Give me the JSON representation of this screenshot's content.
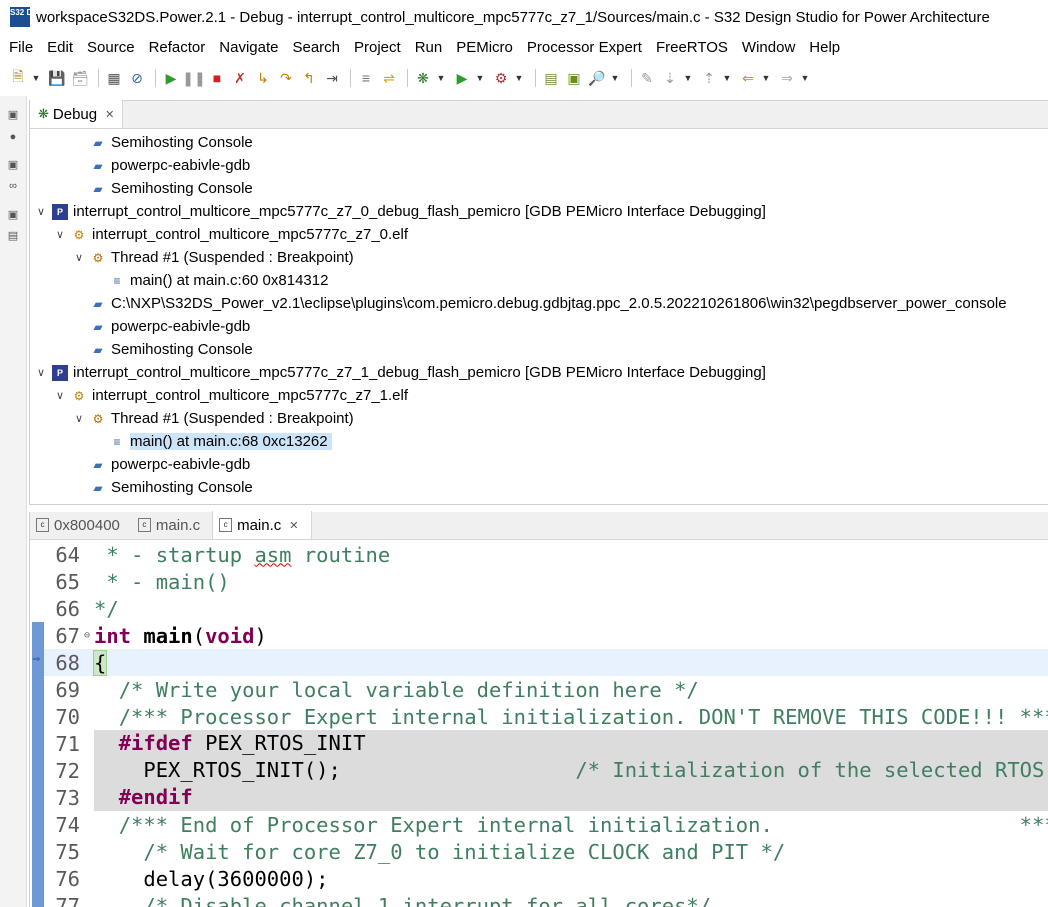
{
  "window": {
    "logo_text": "S32 DS",
    "title": "workspaceS32DS.Power.2.1 - Debug - interrupt_control_multicore_mpc5777c_z7_1/Sources/main.c - S32 Design Studio for Power Architecture"
  },
  "menu": [
    "File",
    "Edit",
    "Source",
    "Refactor",
    "Navigate",
    "Search",
    "Project",
    "Run",
    "PEMicro",
    "Processor Expert",
    "FreeRTOS",
    "Window",
    "Help"
  ],
  "toolbar_icons": [
    "new-icon",
    "save-icon",
    "save-all-icon",
    "binary-icon",
    "skip-breakpoints-icon",
    "resume-icon",
    "suspend-icon",
    "terminate-icon",
    "disconnect-icon",
    "step-into-icon",
    "step-over-icon",
    "step-return-icon",
    "instruction-step-icon",
    "toggle-icon",
    "use-step-filters-icon",
    "debug-icon",
    "run-icon",
    "external-tools-icon",
    "open-type-icon",
    "open-task-icon",
    "search-icon",
    "annotation-icon",
    "next-annotation-icon",
    "prev-annotation-icon",
    "back-icon",
    "forward-icon"
  ],
  "debug_view": {
    "tab_label": "Debug",
    "rows": [
      {
        "level": 2,
        "twisty": "",
        "icon": "process",
        "label": "Semihosting Console"
      },
      {
        "level": 2,
        "twisty": "",
        "icon": "process",
        "label": "powerpc-eabivle-gdb"
      },
      {
        "level": 2,
        "twisty": "",
        "icon": "process",
        "label": "Semihosting Console"
      },
      {
        "level": 0,
        "twisty": "v",
        "icon": "launch",
        "label": "interrupt_control_multicore_mpc5777c_z7_0_debug_flash_pemicro [GDB PEMicro Interface Debugging]"
      },
      {
        "level": 1,
        "twisty": "v",
        "icon": "elf",
        "label": "interrupt_control_multicore_mpc5777c_z7_0.elf"
      },
      {
        "level": 2,
        "twisty": "v",
        "icon": "thread",
        "label": "Thread #1 (Suspended : Breakpoint)"
      },
      {
        "level": 3,
        "twisty": "",
        "icon": "frame",
        "label": "main() at main.c:60 0x814312"
      },
      {
        "level": 2,
        "twisty": "",
        "icon": "process",
        "label": "C:\\NXP\\S32DS_Power_v2.1\\eclipse\\plugins\\com.pemicro.debug.gdbjtag.ppc_2.0.5.202210261806\\win32\\pegdbserver_power_console"
      },
      {
        "level": 2,
        "twisty": "",
        "icon": "process",
        "label": "powerpc-eabivle-gdb"
      },
      {
        "level": 2,
        "twisty": "",
        "icon": "process",
        "label": "Semihosting Console"
      },
      {
        "level": 0,
        "twisty": "v",
        "icon": "launch",
        "label": "interrupt_control_multicore_mpc5777c_z7_1_debug_flash_pemicro [GDB PEMicro Interface Debugging]"
      },
      {
        "level": 1,
        "twisty": "v",
        "icon": "elf",
        "label": "interrupt_control_multicore_mpc5777c_z7_1.elf"
      },
      {
        "level": 2,
        "twisty": "v",
        "icon": "thread",
        "label": "Thread #1 (Suspended : Breakpoint)"
      },
      {
        "level": 3,
        "twisty": "",
        "icon": "frame",
        "label": "main() at main.c:68 0xc13262",
        "selected": true
      },
      {
        "level": 2,
        "twisty": "",
        "icon": "process",
        "label": "powerpc-eabivle-gdb"
      },
      {
        "level": 2,
        "twisty": "",
        "icon": "process",
        "label": "Semihosting Console"
      }
    ]
  },
  "editor": {
    "tabs": [
      {
        "label": "0x800400",
        "active": false
      },
      {
        "label": "main.c",
        "active": false
      },
      {
        "label": "main.c",
        "active": true
      }
    ],
    "lines": [
      {
        "n": "64",
        "text": " * - startup asm routine"
      },
      {
        "n": "65",
        "text": " * - main()"
      },
      {
        "n": "66",
        "text": "*/"
      },
      {
        "n": "67",
        "text": "int main(void)"
      },
      {
        "n": "68",
        "text": "{"
      },
      {
        "n": "69",
        "text": "  /* Write your local variable definition here */"
      },
      {
        "n": "70",
        "text": "  /*** Processor Expert internal initialization. DON'T REMOVE THIS CODE!!! ***/"
      },
      {
        "n": "71",
        "text": "  #ifdef PEX_RTOS_INIT"
      },
      {
        "n": "72",
        "text": "    PEX_RTOS_INIT();                   /* Initialization of the selected RTOS. */"
      },
      {
        "n": "73",
        "text": "  #endif"
      },
      {
        "n": "74",
        "text": "  /*** End of Processor Expert internal initialization.                    ***/"
      },
      {
        "n": "75",
        "text": "    /* Wait for core Z7_0 to initialize CLOCK and PIT */"
      },
      {
        "n": "76",
        "text": "    delay(3600000);"
      },
      {
        "n": "77",
        "text": "    /* Disable channel 1 interrupt for all cores*/"
      }
    ]
  }
}
